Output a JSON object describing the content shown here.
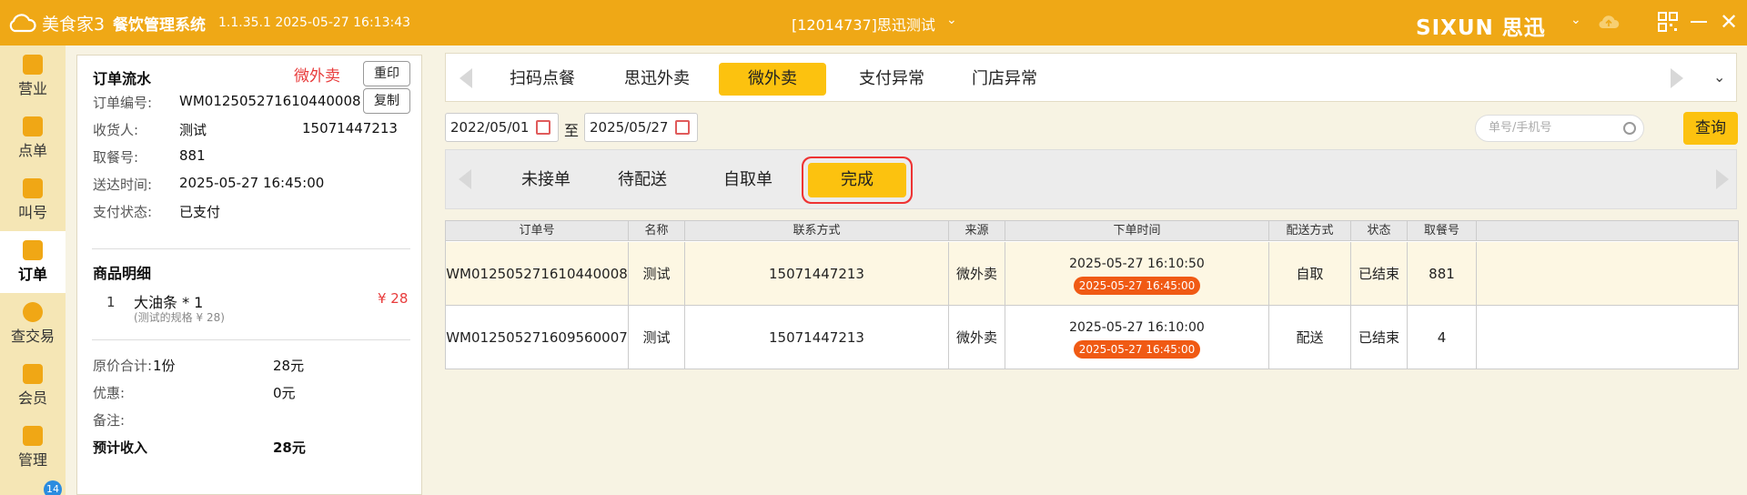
{
  "titlebar": {
    "app_name": "美食家3",
    "system_name": "餐饮管理系统",
    "version": "1.1.35.1 2025-05-27 16:13:43",
    "store": "[12014737]思迅测试",
    "brand": "SIXUN 思迅"
  },
  "leftnav": {
    "items": [
      {
        "label": "营业",
        "icon": "business-icon"
      },
      {
        "label": "点单",
        "icon": "order-hand-icon"
      },
      {
        "label": "叫号",
        "icon": "call-number-icon"
      },
      {
        "label": "订单",
        "icon": "orders-icon",
        "active": true
      },
      {
        "label": "查交易",
        "icon": "search-trade-icon"
      },
      {
        "label": "会员",
        "icon": "member-icon"
      },
      {
        "label": "管理",
        "icon": "manage-icon"
      }
    ],
    "badge": "14"
  },
  "detail": {
    "title": "订单流水",
    "source": "微外卖",
    "reprint": "重印",
    "copy": "复制",
    "order_no_label": "订单编号:",
    "order_no": "WM012505271610440008",
    "receiver_label": "收货人:",
    "receiver": "测试",
    "receiver_phone": "15071447213",
    "pickup_label": "取餐号:",
    "pickup": "881",
    "delivery_time_label": "送达时间:",
    "delivery_time": "2025-05-27 16:45:00",
    "pay_status_label": "支付状态:",
    "pay_status": "已支付",
    "goods_title": "商品明细",
    "goods": [
      {
        "index": "1",
        "name": "大油条 * 1",
        "spec": "(测试的规格 ¥ 28)",
        "price": "¥ 28"
      }
    ],
    "original_total_label": "原价合计:",
    "original_qty": "1份",
    "original_total": "28元",
    "discount_label": "优惠:",
    "discount": "0元",
    "remark_label": "备注:",
    "expected_label": "预计收入",
    "expected": "28元"
  },
  "tabs": [
    "扫码点餐",
    "思迅外卖",
    "微外卖",
    "支付异常",
    "门店异常"
  ],
  "active_tab": "微外卖",
  "filter": {
    "date_from": "2022/05/01",
    "to": "至",
    "date_to": "2025/05/27",
    "search_placeholder": "单号/手机号",
    "query": "查询"
  },
  "subtabs": [
    "未接单",
    "待配送",
    "自取单",
    "完成"
  ],
  "active_subtab": "完成",
  "table": {
    "headers": [
      "订单号",
      "名称",
      "联系方式",
      "来源",
      "下单时间",
      "配送方式",
      "状态",
      "取餐号"
    ],
    "rows": [
      {
        "order_no": "WM012505271610440008",
        "name": "测试",
        "phone": "15071447213",
        "source": "微外卖",
        "order_time": "2025-05-27 16:10:50",
        "due_time": "2025-05-27 16:45:00",
        "delivery": "自取",
        "status": "已结束",
        "pickup": "881"
      },
      {
        "order_no": "WM012505271609560007",
        "name": "测试",
        "phone": "15071447213",
        "source": "微外卖",
        "order_time": "2025-05-27 16:10:00",
        "due_time": "2025-05-27 16:45:00",
        "delivery": "配送",
        "status": "已结束",
        "pickup": "4"
      }
    ]
  },
  "colors": {
    "accent": "#efa816",
    "highlight": "#fcc20f",
    "alert": "#e83b3b",
    "time_badge": "#f05a14"
  }
}
